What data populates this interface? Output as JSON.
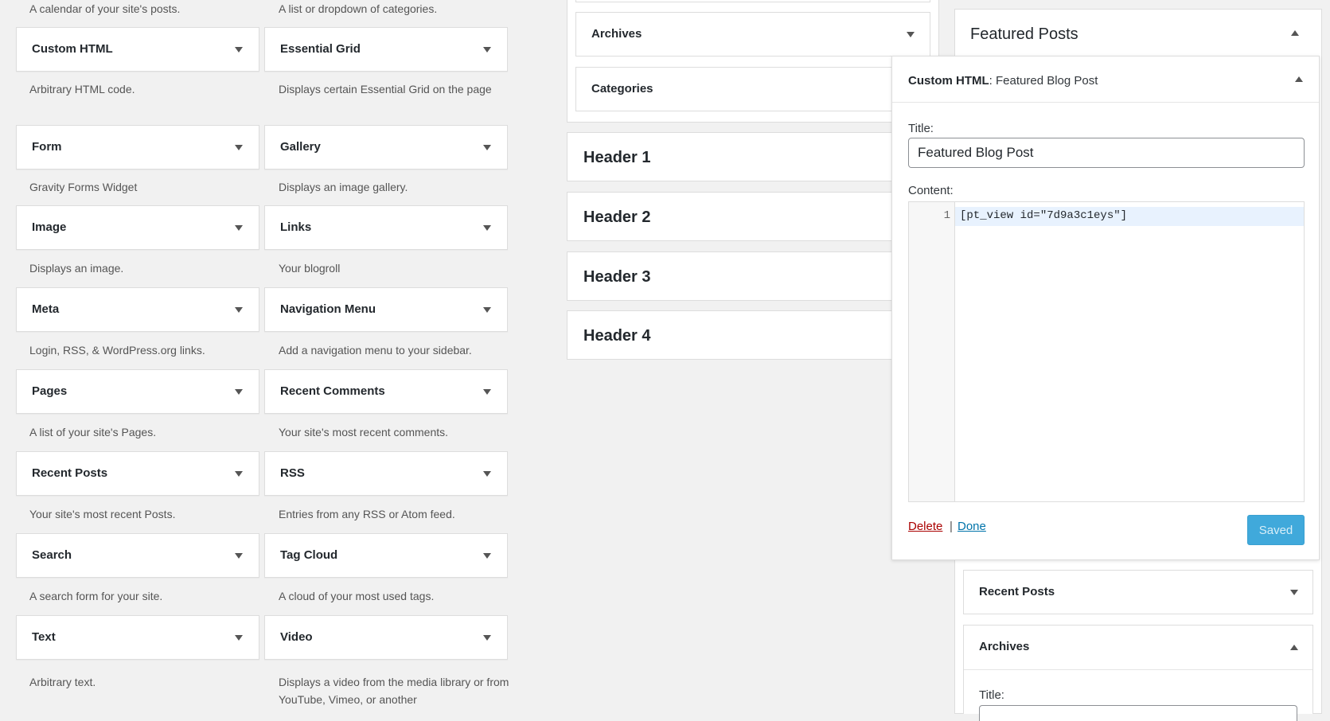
{
  "available_widgets": {
    "top_descriptions": {
      "left": "A calendar of your site's posts.",
      "right": "A list or dropdown of categories."
    },
    "items": [
      {
        "title": "Custom HTML",
        "desc": "Arbitrary HTML code."
      },
      {
        "title": "Essential Grid",
        "desc": "Displays certain Essential Grid on the page"
      },
      {
        "title": "Form",
        "desc": "Gravity Forms Widget"
      },
      {
        "title": "Gallery",
        "desc": "Displays an image gallery."
      },
      {
        "title": "Image",
        "desc": "Displays an image."
      },
      {
        "title": "Links",
        "desc": "Your blogroll"
      },
      {
        "title": "Meta",
        "desc": "Login, RSS, & WordPress.org links."
      },
      {
        "title": "Navigation Menu",
        "desc": "Add a navigation menu to your sidebar."
      },
      {
        "title": "Pages",
        "desc": "A list of your site's Pages."
      },
      {
        "title": "Recent Comments",
        "desc": "Your site's most recent comments."
      },
      {
        "title": "Recent Posts",
        "desc": "Your site's most recent Posts."
      },
      {
        "title": "RSS",
        "desc": "Entries from any RSS or Atom feed."
      },
      {
        "title": "Search",
        "desc": "A search form for your site."
      },
      {
        "title": "Tag Cloud",
        "desc": "A cloud of your most used tags."
      },
      {
        "title": "Text",
        "desc": "Arbitrary text."
      },
      {
        "title": "Video",
        "desc": "Displays a video from the media library or from YouTube, Vimeo, or another"
      }
    ]
  },
  "middle": {
    "widgets": [
      "Archives",
      "Categories"
    ],
    "headers": [
      "Header 1",
      "Header 2",
      "Header 3",
      "Header 4"
    ]
  },
  "featured": {
    "area_title": "Featured Posts",
    "editor": {
      "type_label": "Custom HTML",
      "separator": ":",
      "instance_title": "Featured Blog Post",
      "title_label": "Title:",
      "title_value": "Featured Blog Post",
      "content_label": "Content:",
      "line_number": "1",
      "code": "[pt_view id=\"7d9a3c1eys\"]",
      "delete_label": "Delete",
      "pipe": "|",
      "done_label": "Done",
      "saved_label": "Saved"
    },
    "below_widgets": [
      {
        "title": "Recent Posts"
      },
      {
        "title": "Archives",
        "title_label": "Title:"
      }
    ]
  },
  "colors": {
    "background": "#f1f1f1",
    "delete_link": "#aa0000",
    "done_link": "#0073aa",
    "saved_button": "#40a9db",
    "active_line": "#e8f2fe"
  }
}
